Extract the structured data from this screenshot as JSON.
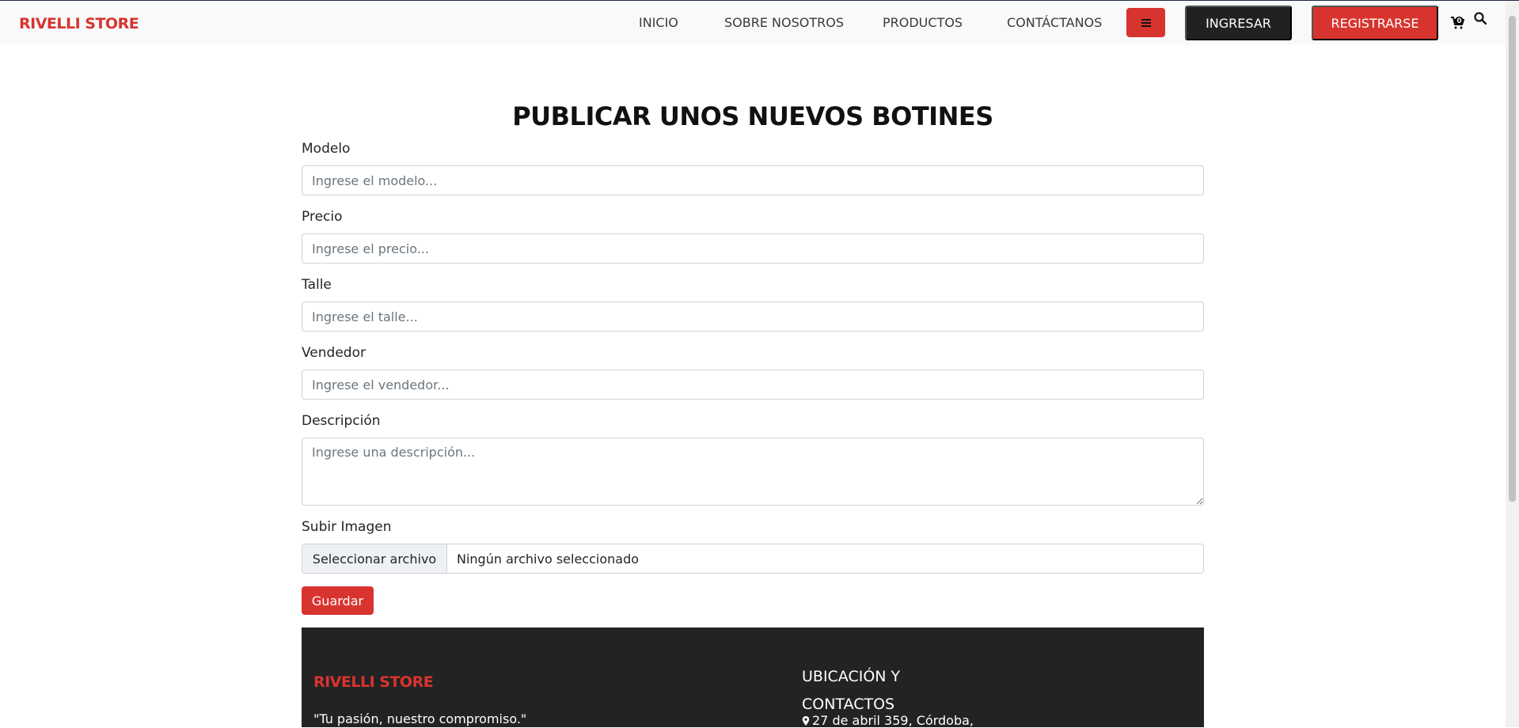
{
  "navbar": {
    "brand": "RIVELLI STORE",
    "links": [
      "INICIO",
      "SOBRE NOSOTROS",
      "PRODUCTOS",
      "CONTÁCTANOS"
    ],
    "login_label": "INGRESAR",
    "register_label": "REGISTRARSE",
    "cart_count": "0",
    "menu_icon": "bars-icon",
    "cart_icon": "cart-icon",
    "search_icon": "search-icon"
  },
  "main": {
    "title": "PUBLICAR UNOS NUEVOS BOTINES",
    "fields": {
      "modelo": {
        "label": "Modelo",
        "placeholder": "Ingrese el modelo...",
        "value": ""
      },
      "precio": {
        "label": "Precio",
        "placeholder": "Ingrese el precio...",
        "value": ""
      },
      "talle": {
        "label": "Talle",
        "placeholder": "Ingrese el talle...",
        "value": ""
      },
      "vendedor": {
        "label": "Vendedor",
        "placeholder": "Ingrese el vendedor...",
        "value": ""
      },
      "descripcion": {
        "label": "Descripción",
        "placeholder": "Ingrese una descripción...",
        "value": ""
      },
      "imagen": {
        "label": "Subir Imagen",
        "button_label": "Seleccionar archivo",
        "status": "Ningún archivo seleccionado"
      }
    },
    "save_label": "Guardar"
  },
  "footer": {
    "brand": "RIVELLI STORE",
    "slogan": "\"Tu pasión, nuestro compromiso.\"",
    "location_heading": "UBICACIÓN Y CONTACTOS",
    "address": "27 de abril 359, Córdoba,"
  },
  "colors": {
    "accent": "#d8342f",
    "dark": "#232323",
    "navbar_bg": "#f8f9fa"
  }
}
